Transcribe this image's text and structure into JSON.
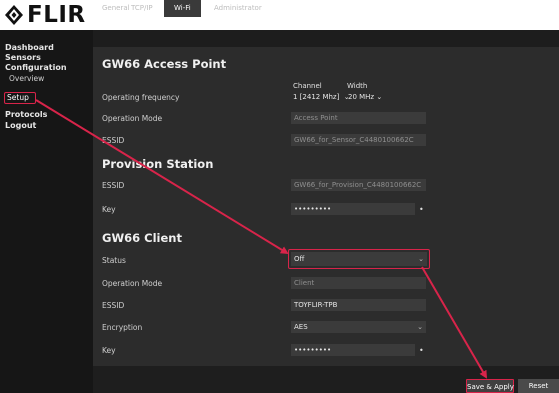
{
  "brand": {
    "logo_text": "FLIR",
    "logo_icon": "flir-diamond-icon",
    "accent_color": "#d8244a"
  },
  "sidebar": {
    "items": [
      {
        "label": "Dashboard"
      },
      {
        "label": "Sensors"
      },
      {
        "label": "Configuration"
      },
      {
        "label": "Overview"
      },
      {
        "label": "Setup"
      },
      {
        "label": "Protocols"
      },
      {
        "label": "Logout"
      }
    ]
  },
  "tabs": [
    {
      "label": "General"
    },
    {
      "label": "TCP/IP"
    },
    {
      "label": "Wi-Fi",
      "active": true
    },
    {
      "label": "Administrator"
    }
  ],
  "access_point": {
    "title": "GW66 Access Point",
    "channel_header": "Channel",
    "width_header": "Width",
    "operating_frequency_label": "Operating frequency",
    "channel_value": "1 [2412 Mhz]",
    "width_value": "20 MHz",
    "operation_mode_label": "Operation Mode",
    "operation_mode_value": "Access Point",
    "essid_label": "ESSID",
    "essid_value": "GW66_for_Sensor_C4480100662C"
  },
  "provision_station": {
    "title": "Provision Station",
    "essid_label": "ESSID",
    "essid_value": "GW66_for_Provision_C4480100662C",
    "key_label": "Key",
    "key_value": "•••••••••"
  },
  "client": {
    "title": "GW66 Client",
    "status_label": "Status",
    "status_value": "Off",
    "operation_mode_label": "Operation Mode",
    "operation_mode_value": "Client",
    "essid_label": "ESSID",
    "essid_value": "TOYFLIR-TPB",
    "encryption_label": "Encryption",
    "encryption_value": "AES",
    "key_label": "Key",
    "key_value": "•••••••••"
  },
  "footer": {
    "save_label": "Save & Apply",
    "reset_label": "Reset"
  }
}
